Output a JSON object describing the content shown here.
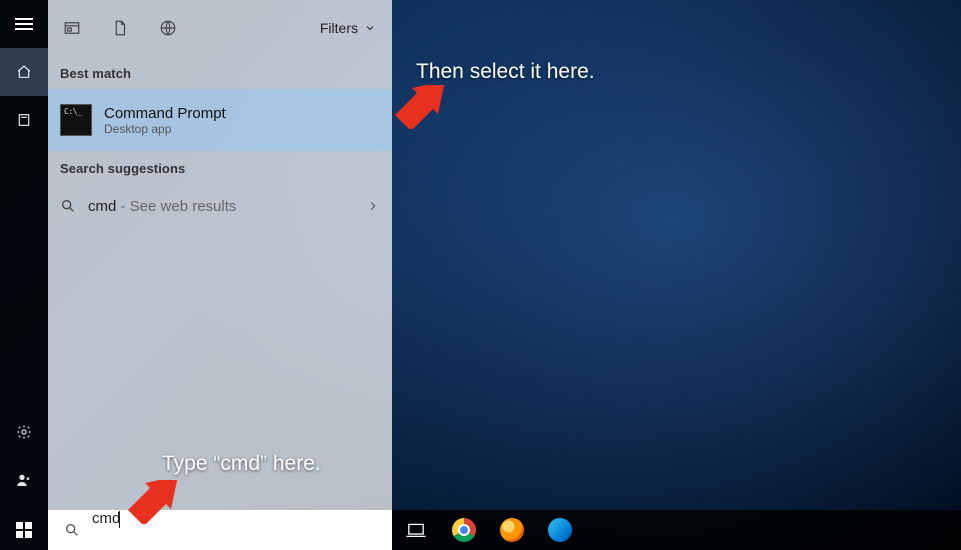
{
  "panel": {
    "filters_label": "Filters",
    "best_match_label": "Best match",
    "best_match": {
      "title": "Command Prompt",
      "subtitle": "Desktop app"
    },
    "suggestions_label": "Search suggestions",
    "suggestion": {
      "term": "cmd",
      "tail": " - See web results"
    }
  },
  "search": {
    "value": "cmd"
  },
  "annotations": {
    "top": "Then select it here.",
    "bottom": "Type “cmd” here."
  }
}
